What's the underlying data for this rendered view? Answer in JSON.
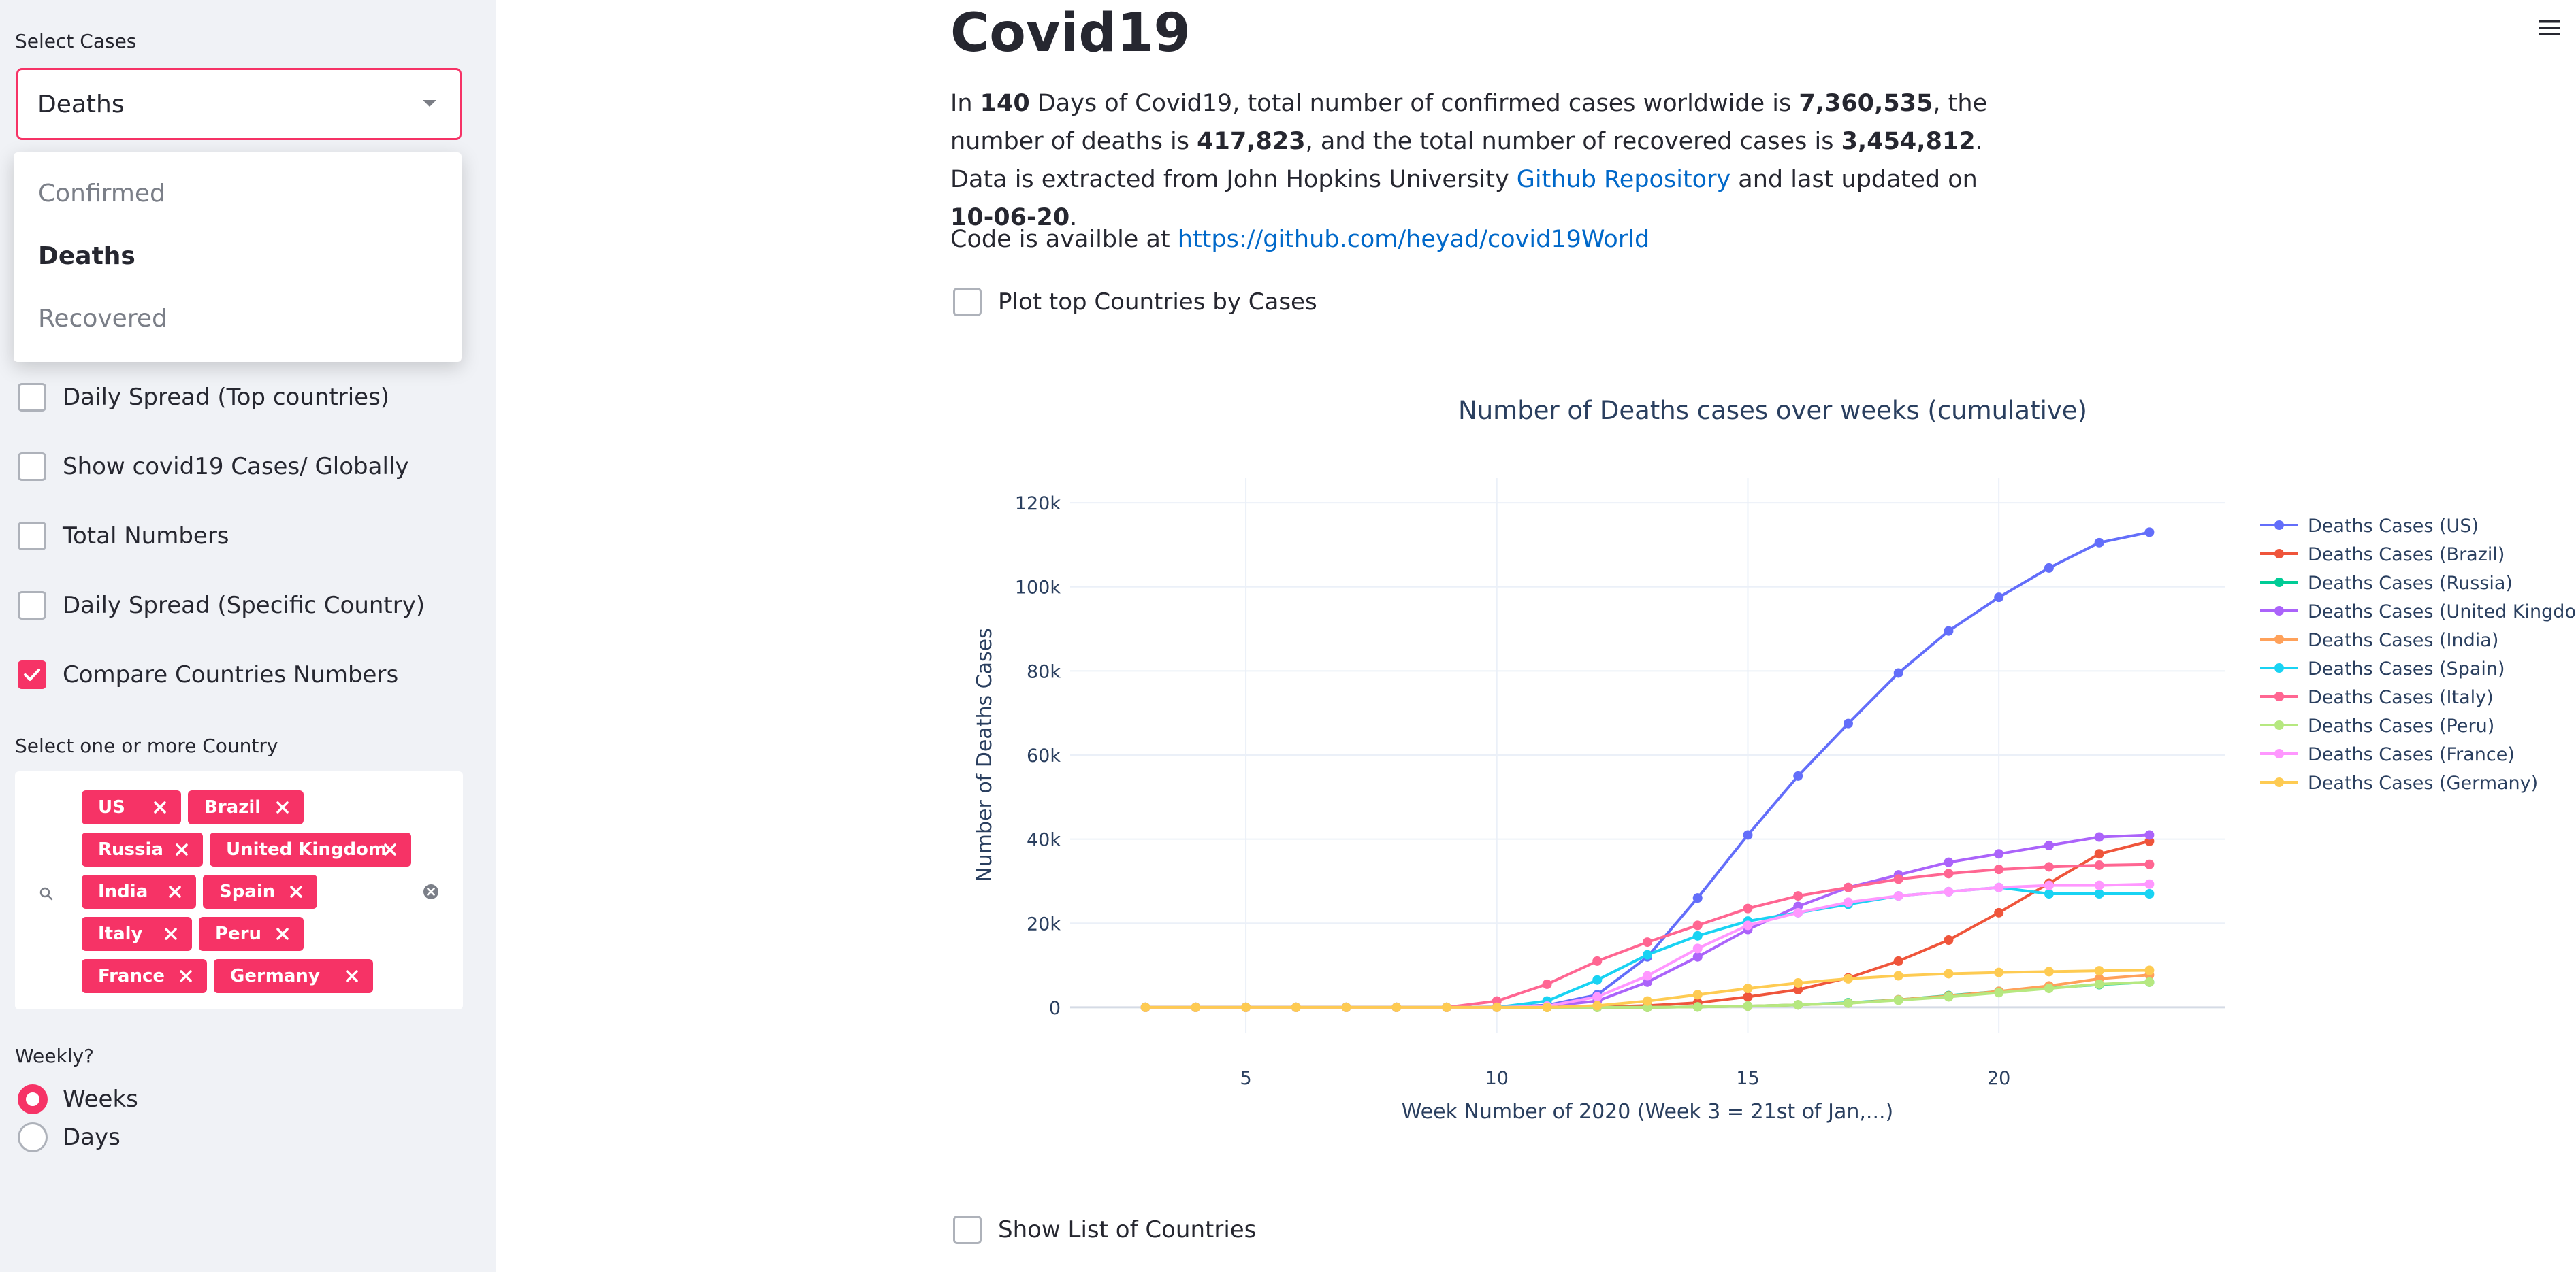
{
  "sidebar": {
    "select_cases_label": "Select Cases",
    "select_cases_value": "Deaths",
    "select_cases_options": [
      {
        "label": "Confirmed",
        "selected": false
      },
      {
        "label": "Deaths",
        "selected": true
      },
      {
        "label": "Recovered",
        "selected": false
      }
    ],
    "checkboxes": [
      {
        "label": "Daily Spread (Top countries)",
        "checked": false
      },
      {
        "label": "Show covid19 Cases/ Globally",
        "checked": false
      },
      {
        "label": "Total Numbers",
        "checked": false
      },
      {
        "label": "Daily Spread (Specific Country)",
        "checked": false
      },
      {
        "label": "Compare Countries Numbers",
        "checked": true
      }
    ],
    "country_label": "Select one or more Country",
    "countries": [
      "US",
      "Brazil",
      "Russia",
      "United Kingdom",
      "India",
      "Spain",
      "Italy",
      "Peru",
      "France",
      "Germany"
    ],
    "weekly_label": "Weekly?",
    "weekly_options": [
      {
        "label": "Weeks",
        "selected": true
      },
      {
        "label": "Days",
        "selected": false
      }
    ]
  },
  "main": {
    "title": "Covid19",
    "intro": {
      "p1": "In ",
      "days": "140",
      "p2": " Days of Covid19, total number of confirmed cases worldwide is ",
      "confirmed": "7,360,535",
      "p3": ", the number of deaths is ",
      "deaths": "417,823",
      "p4": ", and the total number of recovered cases is ",
      "recovered": "3,454,812",
      "p5": ". Data is extracted from John Hopkins University ",
      "repo_link": "Github Repository",
      "p6": " and last updated on ",
      "updated": "10-06-20",
      "p7": "."
    },
    "code_prefix": "Code is availble at ",
    "code_link": "https://github.com/heyad/covid19World",
    "plot_top_label": "Plot top Countries by Cases",
    "show_list_label": "Show List of Countries"
  },
  "colors": {
    "accent": "#f63366",
    "link": "#0068c9",
    "sidebar_bg": "#f0f2f6"
  },
  "chart_data": {
    "type": "line",
    "title": "Number of Deaths cases over weeks (cumulative)",
    "xlabel": "Week Number of 2020 (Week 3 = 21st of Jan,...)",
    "ylabel": "Number of Deaths Cases",
    "xlim": [
      1.5,
      24.5
    ],
    "ylim": [
      -6000,
      126000
    ],
    "xticks": [
      5,
      10,
      15,
      20
    ],
    "yticks": [
      0,
      20000,
      40000,
      60000,
      80000,
      100000,
      120000
    ],
    "ytick_labels": [
      "0",
      "20k",
      "40k",
      "60k",
      "80k",
      "100k",
      "120k"
    ],
    "grid": true,
    "legend_position": "right",
    "x": [
      3,
      4,
      5,
      6,
      7,
      8,
      9,
      10,
      11,
      12,
      13,
      14,
      15,
      16,
      17,
      18,
      19,
      20,
      21,
      22,
      23
    ],
    "series": [
      {
        "name": "Deaths Cases (US)",
        "color": "#636efa",
        "values": [
          0,
          0,
          0,
          0,
          0,
          0,
          0,
          100,
          500,
          3000,
          12000,
          26000,
          41000,
          55000,
          67500,
          79500,
          89500,
          97500,
          104500,
          110500,
          113000
        ]
      },
      {
        "name": "Deaths Cases (Brazil)",
        "color": "#ef553b",
        "values": [
          0,
          0,
          0,
          0,
          0,
          0,
          0,
          0,
          0,
          100,
          400,
          1100,
          2500,
          4200,
          7000,
          11000,
          16000,
          22500,
          29500,
          36500,
          39500
        ]
      },
      {
        "name": "Deaths Cases (Russia)",
        "color": "#00cc96",
        "values": [
          0,
          0,
          0,
          0,
          0,
          0,
          0,
          0,
          0,
          0,
          0,
          100,
          300,
          600,
          1100,
          1800,
          2800,
          3800,
          4600,
          5400,
          6000
        ]
      },
      {
        "name": "Deaths Cases (United Kingdom)",
        "color": "#ab63fa",
        "values": [
          0,
          0,
          0,
          0,
          0,
          0,
          0,
          0,
          300,
          1500,
          6000,
          12000,
          18500,
          24000,
          28500,
          31500,
          34500,
          36500,
          38500,
          40500,
          41000
        ]
      },
      {
        "name": "Deaths Cases (India)",
        "color": "#ffa15a",
        "values": [
          0,
          0,
          0,
          0,
          0,
          0,
          0,
          0,
          0,
          0,
          0,
          100,
          300,
          600,
          1000,
          1800,
          2700,
          3800,
          5100,
          6800,
          7700
        ]
      },
      {
        "name": "Deaths Cases (Spain)",
        "color": "#19d3f3",
        "values": [
          0,
          0,
          0,
          0,
          0,
          0,
          0,
          0,
          1500,
          6500,
          12500,
          17000,
          20500,
          22500,
          24500,
          26500,
          27500,
          28500,
          27000,
          27000,
          27000
        ]
      },
      {
        "name": "Deaths Cases (Italy)",
        "color": "#ff6692",
        "values": [
          0,
          0,
          0,
          0,
          0,
          0,
          0,
          1500,
          5500,
          11000,
          15500,
          19500,
          23500,
          26500,
          28500,
          30500,
          31800,
          32800,
          33400,
          33800,
          34000
        ]
      },
      {
        "name": "Deaths Cases (Peru)",
        "color": "#b6e880",
        "values": [
          0,
          0,
          0,
          0,
          0,
          0,
          0,
          0,
          0,
          0,
          0,
          100,
          300,
          600,
          1000,
          1700,
          2500,
          3500,
          4500,
          5500,
          6000
        ]
      },
      {
        "name": "Deaths Cases (France)",
        "color": "#ff97ff",
        "values": [
          0,
          0,
          0,
          0,
          0,
          0,
          0,
          0,
          300,
          2500,
          7500,
          14000,
          19500,
          22500,
          25000,
          26500,
          27500,
          28500,
          29000,
          29000,
          29300
        ]
      },
      {
        "name": "Deaths Cases (Germany)",
        "color": "#fecb52",
        "values": [
          0,
          0,
          0,
          0,
          0,
          0,
          0,
          0,
          0,
          400,
          1500,
          3000,
          4500,
          5800,
          6800,
          7500,
          8000,
          8300,
          8500,
          8700,
          8800
        ]
      }
    ]
  }
}
